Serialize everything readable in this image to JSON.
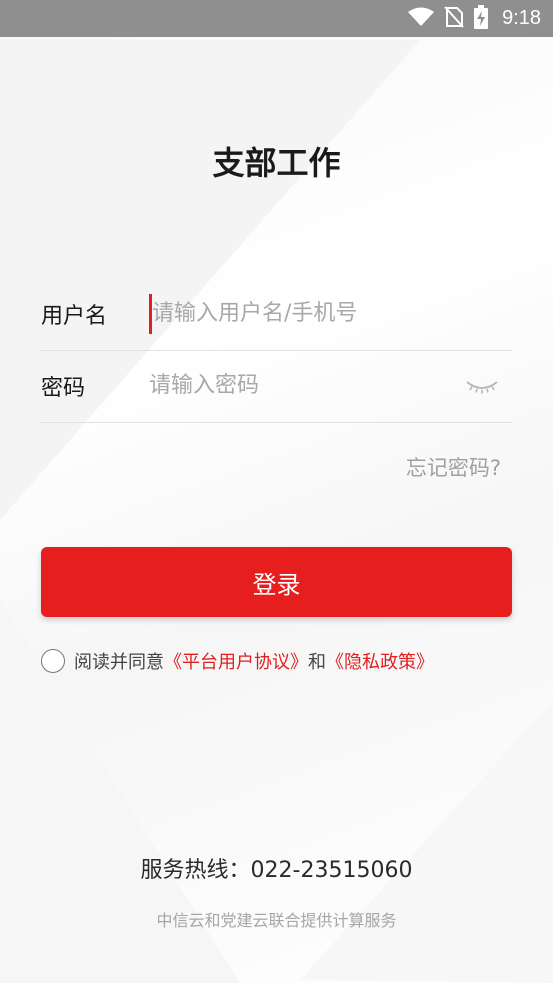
{
  "status_bar": {
    "time": "9:18",
    "icons": [
      "wifi-icon",
      "no-sim-icon",
      "battery-charging-icon"
    ]
  },
  "app": {
    "title": "支部工作"
  },
  "login_form": {
    "username_label": "用户名",
    "username_placeholder": "请输入用户名/手机号",
    "password_label": "密码",
    "password_placeholder": "请输入密码",
    "forgot_password": "忘记密码?",
    "login_button": "登录"
  },
  "agreement": {
    "prefix": "阅读并同意",
    "user_agreement": "《平台用户协议》",
    "conjunction": "和",
    "privacy_policy": "《隐私政策》",
    "checked": false
  },
  "footer": {
    "hotline": "服务热线：022-23515060",
    "provider": "中信云和党建云联合提供计算服务"
  },
  "colors": {
    "accent": "#e61e1e",
    "link": "#e02020",
    "status_bar": "#8f8f8f"
  }
}
